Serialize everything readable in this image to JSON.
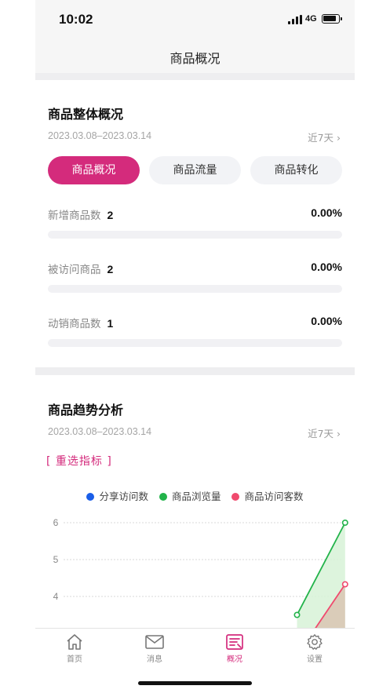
{
  "status_bar": {
    "time": "10:02",
    "network": "4G"
  },
  "navbar": {
    "title": "商品概况"
  },
  "overview": {
    "title": "商品整体概况",
    "date_range": "2023.03.08–2023.03.14",
    "period": "近7天",
    "tabs": [
      {
        "label": "商品概况",
        "active": true
      },
      {
        "label": "商品流量",
        "active": false
      },
      {
        "label": "商品转化",
        "active": false
      }
    ],
    "metrics": [
      {
        "label": "新增商品数",
        "value": "2",
        "percent": "0.00%",
        "progress": 0
      },
      {
        "label": "被访问商品",
        "value": "2",
        "percent": "0.00%",
        "progress": 0
      },
      {
        "label": "动销商品数",
        "value": "1",
        "percent": "0.00%",
        "progress": 0
      }
    ]
  },
  "trend": {
    "title": "商品趋势分析",
    "date_range": "2023.03.08–2023.03.14",
    "period": "近7天",
    "reselect_label": "[ 重选指标 ]"
  },
  "chart_data": {
    "type": "area",
    "title": "",
    "xlabel": "",
    "ylabel": "",
    "ylim": [
      3,
      6
    ],
    "yticks": [
      6,
      5,
      4
    ],
    "grid": true,
    "legend_position": "top",
    "series": [
      {
        "name": "分享访问数",
        "color": "#1a5ee8",
        "x": [],
        "y": []
      },
      {
        "name": "商品浏览量",
        "color": "#22b34a",
        "fill": "#d7f2d7",
        "x": [
          5,
          6
        ],
        "y": [
          3.5,
          6
        ]
      },
      {
        "name": "商品访问客数",
        "color": "#f04a6e",
        "fill": "#d9c4b3",
        "x": [
          5,
          6
        ],
        "y": [
          2.4,
          4.33
        ]
      }
    ]
  },
  "tabbar": {
    "items": [
      {
        "label": "首页",
        "icon": "home-icon",
        "active": false
      },
      {
        "label": "消息",
        "icon": "mail-icon",
        "active": false
      },
      {
        "label": "概况",
        "icon": "overview-icon",
        "active": true
      },
      {
        "label": "设置",
        "icon": "gear-icon",
        "active": false
      }
    ]
  },
  "colors": {
    "accent": "#d42b7c",
    "muted": "#a5a5a5",
    "track": "#f1f1f4"
  }
}
